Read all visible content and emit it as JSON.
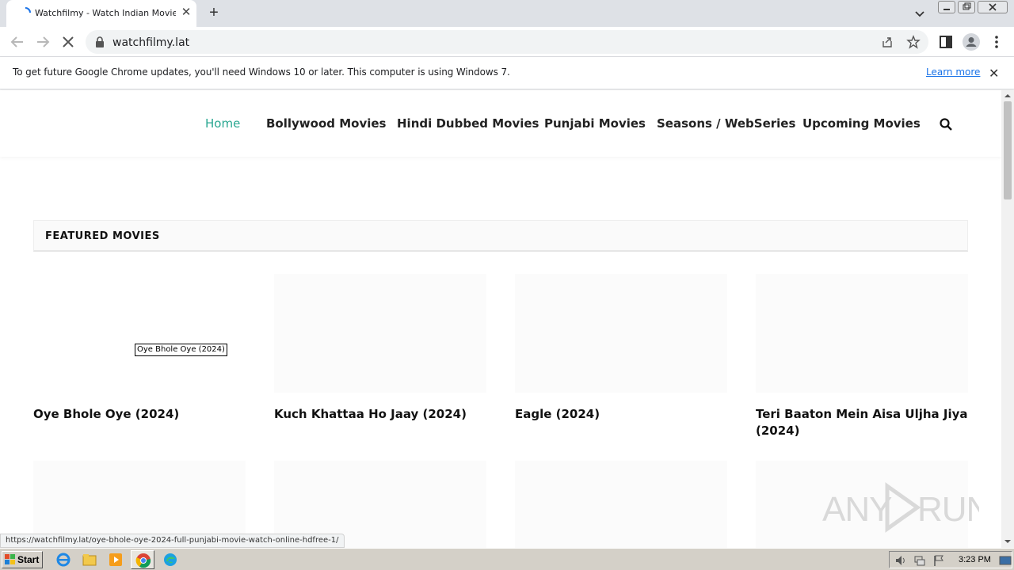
{
  "browser": {
    "tab_title": "Watchfilmy - Watch Indian Movies O",
    "tab_close": "✕",
    "new_tab": "+",
    "url": "watchfilmy.lat",
    "infobar_text": "To get future Google Chrome updates, you'll need Windows 10 or later. This computer is using Windows 7.",
    "infobar_link": "Learn more",
    "infobar_close": "✕",
    "status_url": "https://watchfilmy.lat/oye-bhole-oye-2024-full-punjabi-movie-watch-online-hdfree-1/"
  },
  "nav": {
    "items": [
      {
        "label": "Home",
        "active": true
      },
      {
        "label": "Bollywood Movies"
      },
      {
        "label": "Hindi Dubbed Movies"
      },
      {
        "label": "Punjabi Movies"
      },
      {
        "label": "Seasons / WebSeries"
      },
      {
        "label": "Upcoming Movies"
      }
    ]
  },
  "featured": {
    "title": "FEATURED MOVIES",
    "movies": [
      {
        "title": "Oye Bhole Oye (2024)"
      },
      {
        "title": "Kuch Khattaa Ho Jaay (2024)"
      },
      {
        "title": "Eagle (2024)"
      },
      {
        "title": "Teri Baaton Mein Aisa Uljha Jiya (2024)"
      }
    ],
    "alt_tooltip": "Oye Bhole Oye (2024)"
  },
  "watermark": {
    "text": "ANY RUN"
  },
  "taskbar": {
    "start": "Start",
    "clock": "3:23 PM"
  },
  "colors": {
    "accent": "#2aa791",
    "link": "#1a73e8"
  }
}
